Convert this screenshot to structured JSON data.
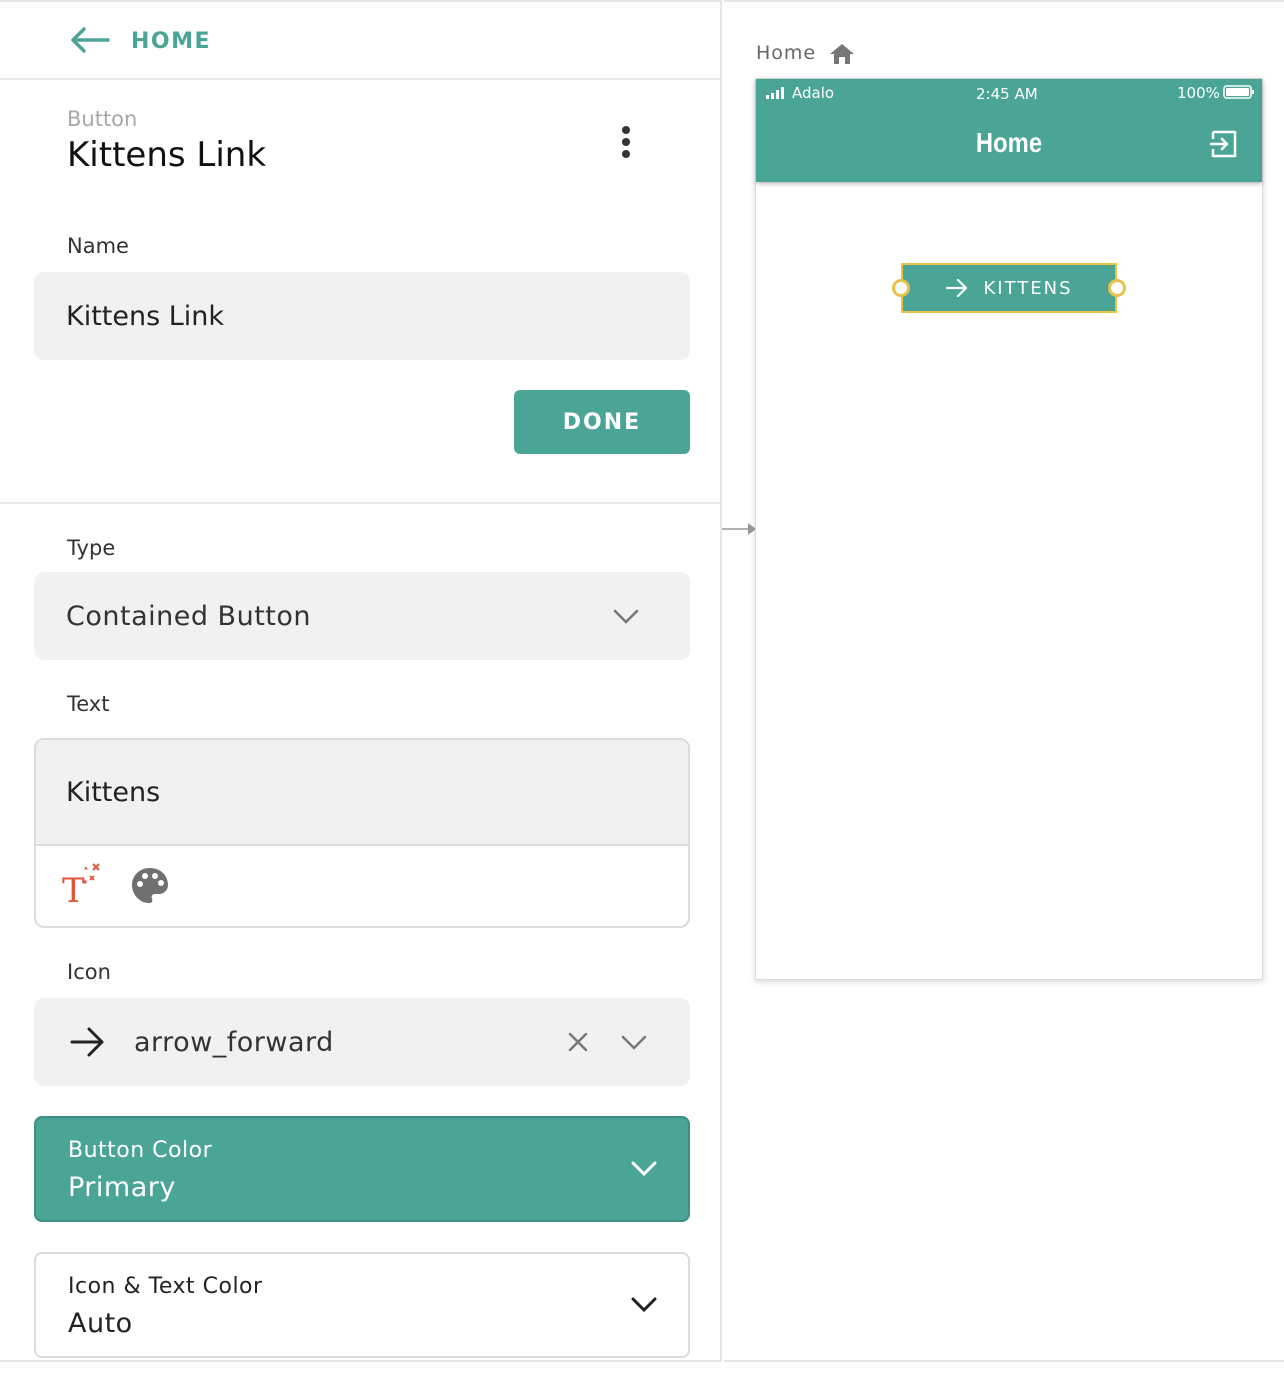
{
  "nav": {
    "back_label": "HOME"
  },
  "component": {
    "type_label": "Button",
    "name": "Kittens Link"
  },
  "name_field": {
    "label": "Name",
    "value": "Kittens Link"
  },
  "done_button": {
    "label": "DONE"
  },
  "type_field": {
    "label": "Type",
    "value": "Contained Button"
  },
  "text_field": {
    "label": "Text",
    "value": "Kittens",
    "magic_text_icon": "magic-text-icon",
    "palette_icon": "palette-icon"
  },
  "icon_field": {
    "label": "Icon",
    "value": "arrow_forward",
    "icon": "arrow-forward-icon"
  },
  "button_color": {
    "label": "Button Color",
    "value": "Primary",
    "color": "#4aa596"
  },
  "icon_text_color": {
    "label": "Icon & Text Color",
    "value": "Auto"
  },
  "canvas": {
    "screen_name": "Home",
    "status_bar": {
      "carrier": "Adalo",
      "time": "2:45 AM",
      "battery": "100%"
    },
    "app_bar_title": "Home",
    "button_label": "KITTENS"
  },
  "colors": {
    "accent": "#4aa596",
    "selection": "#e9c04a"
  }
}
